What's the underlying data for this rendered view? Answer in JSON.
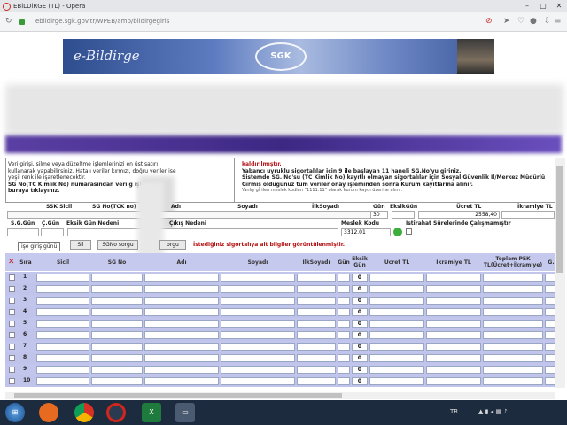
{
  "window": {
    "title": "EBiLDiRGE (TL) - Opera"
  },
  "address": {
    "url": "ebildirge.sgk.gov.tr/WPEB/amp/bildirgegiris"
  },
  "banner": {
    "logo_text": "e-Bildirge",
    "sgk_text": "SGK"
  },
  "info": {
    "left_lines": [
      "Veri girişi, silme veya düzeltme işlemlerinizi en üst satırı",
      "kullanarak yapabilirsiniz. Hatalı veriler kırmızı, doğru veriler ise",
      "yeşil renk ile işaretlenecektir.",
      "SG No(TC Kimlik No) numarasından veri g              işlemi için",
      "buraya tıklayınız."
    ],
    "right_lines": [
      "kaldırılmıştır.",
      "Yabancı uyruklu sigortalılar için 9 ile başlayan 11 haneli SG.No'yu giriniz.",
      "Sistemde SG. No'su (TC Kimlik No) kayıtlı olmayan sigortalılar için Sosyal Güvenlik İl/Merkez Müdürlü",
      "Girmiş olduğunuz tüm veriler onay işleminden sonra Kurum kayıtlarına alınır.",
      "Yanlış girilen meslek kodları \"1111.11\" olarak kurum kaydı üzerine alınır."
    ]
  },
  "form": {
    "labels": {
      "ssk_sicil": "SSK Sicil",
      "sg_no": "SG No(TCK no)",
      "adi": "Adı",
      "soyadi": "Soyadı",
      "ilk_soyadi": "İlkSoyadı",
      "gun": "Gün",
      "eksik_gun": "EksikGün",
      "ucret": "Ücret TL",
      "ikramiye": "İkramiye TL",
      "sg_gun": "S.G.Gün",
      "c_gun": "Ç.Gün",
      "eksik_gun_nedeni": "Eksik Gün Nedeni",
      "cikis_nedeni": "Çıkış Nedeni",
      "meslek_kodu": "Meslek Kodu",
      "istirahat": "İstirahat Sürelerinde Çalışmamıştır"
    },
    "gun_value": "30",
    "ucret_value": "2558,40",
    "meslek_value": "3312.01"
  },
  "buttons": {
    "sil": "Sil",
    "sgno_sorgu": "SGNo sorgu",
    "sorgu": "orgu"
  },
  "tooltip": "işe giriş günü",
  "warning": "İstediğiniz sigortalıya ait bilgiler görüntülenmiştir.",
  "table": {
    "headers": [
      "Sıra",
      "Sicil",
      "SG No",
      "Adı",
      "Soyadı",
      "İlkSoyadı",
      "Gün",
      "Eksik Gün",
      "Ücret TL",
      "İkramiye TL",
      "Toplam PEK TL(Ücret+İkramiye)",
      "G."
    ],
    "rows": [
      {
        "no": "1",
        "eksik": "0"
      },
      {
        "no": "2",
        "eksik": "0"
      },
      {
        "no": "3",
        "eksik": "0"
      },
      {
        "no": "4",
        "eksik": "0"
      },
      {
        "no": "5",
        "eksik": "0"
      },
      {
        "no": "6",
        "eksik": "0"
      },
      {
        "no": "7",
        "eksik": "0"
      },
      {
        "no": "8",
        "eksik": "0"
      },
      {
        "no": "9",
        "eksik": "0"
      },
      {
        "no": "10",
        "eksik": "0"
      }
    ]
  },
  "taskbar": {
    "lang": "TR",
    "time": "",
    "apps": [
      "start-orb-icon",
      "firefox-icon",
      "chrome-icon",
      "opera-icon",
      "excel-icon",
      "window-icon"
    ]
  }
}
